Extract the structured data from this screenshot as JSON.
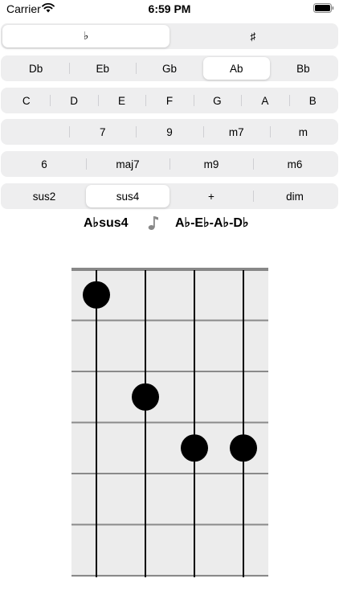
{
  "status_bar": {
    "carrier": "Carrier",
    "time": "6:59 PM",
    "wifi_icon": "wifi-icon",
    "battery_icon": "battery-icon"
  },
  "accidentals": {
    "items": [
      "♭",
      "♯"
    ],
    "selected_index": 0
  },
  "flat_roots": {
    "items": [
      "Db",
      "Eb",
      "Gb",
      "Ab",
      "Bb"
    ],
    "selected_index": 3
  },
  "natural_roots": {
    "items": [
      "C",
      "D",
      "E",
      "F",
      "G",
      "A",
      "B"
    ],
    "selected_index": -1
  },
  "qualities_1": {
    "items": [
      "",
      "7",
      "9",
      "m7",
      "m"
    ],
    "selected_index": -1
  },
  "qualities_2": {
    "items": [
      "6",
      "maj7",
      "m9",
      "m6"
    ],
    "selected_index": -1
  },
  "qualities_3": {
    "items": [
      "sus2",
      "sus4",
      "+",
      "dim"
    ],
    "selected_index": 1
  },
  "chord_info": {
    "name": "A♭sus4",
    "note_icon": "music-note-icon",
    "notes": "A♭-E♭-A♭-D♭"
  },
  "fretboard": {
    "strings": 4,
    "frets": 6,
    "dots": [
      {
        "string": 1,
        "fret": 1
      },
      {
        "string": 2,
        "fret": 3
      },
      {
        "string": 3,
        "fret": 4
      },
      {
        "string": 4,
        "fret": 4
      }
    ],
    "colors": {
      "background": "#ececec",
      "nut": "#888888",
      "fret": "#8a8a8a",
      "string": "#000000",
      "dot": "#000000"
    }
  }
}
